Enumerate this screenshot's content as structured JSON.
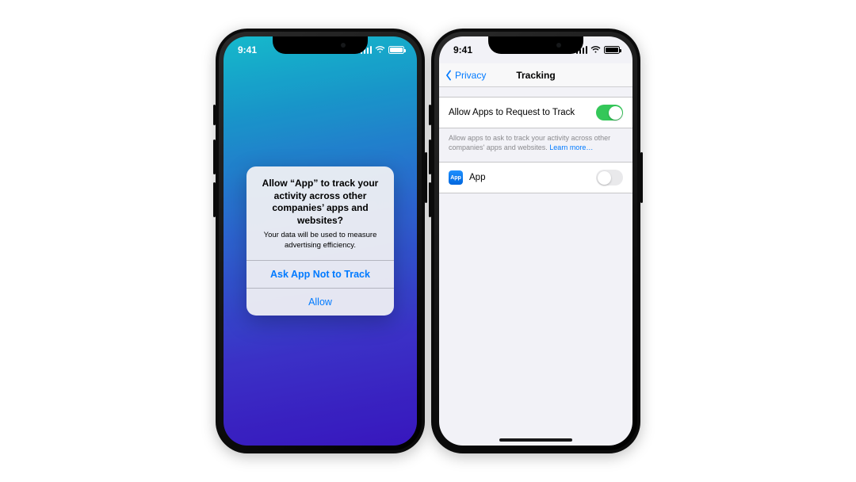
{
  "status_time": "9:41",
  "left_phone": {
    "alert": {
      "title": "Allow “App” to track your activity across other companies’ apps and websites?",
      "message": "Your data will be used to measure advertising efficiency.",
      "deny_label": "Ask App Not to Track",
      "allow_label": "Allow"
    }
  },
  "right_phone": {
    "nav": {
      "back_label": "Privacy",
      "title": "Tracking"
    },
    "master_toggle": {
      "label": "Allow Apps to Request to Track",
      "on": true
    },
    "footer": {
      "text": "Allow apps to ask to track your activity across other companies' apps and websites. ",
      "link": "Learn more…"
    },
    "apps": [
      {
        "name": "App",
        "icon_text": "App",
        "on": false
      }
    ]
  }
}
